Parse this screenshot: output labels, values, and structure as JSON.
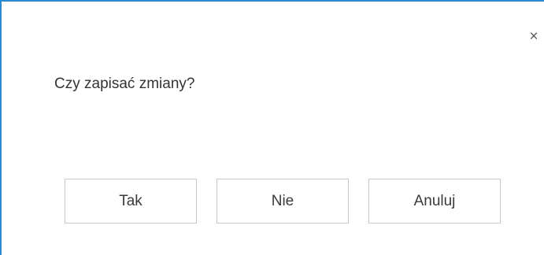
{
  "dialog": {
    "close_glyph": "×",
    "close_icon": "close-icon",
    "message": "Czy zapisać zmiany?",
    "buttons": {
      "yes_label": "Tak",
      "no_label": "Nie",
      "cancel_label": "Anuluj"
    },
    "colors": {
      "accent_border": "#2a8ad4",
      "button_border": "#c8c8c8",
      "text": "#333333"
    }
  }
}
